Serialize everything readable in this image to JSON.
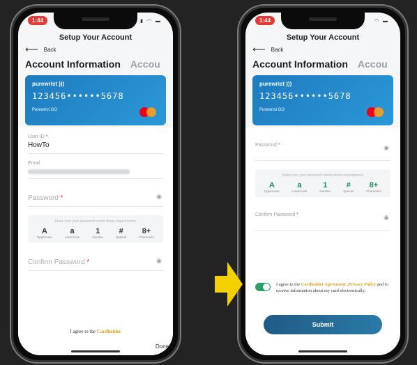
{
  "colors": {
    "accent": "#1e7bc0",
    "required": "#e53935",
    "link": "#d4a017",
    "toggle_on": "#2e9e6a",
    "pointer": "#f5d000"
  },
  "status": {
    "time": "1:44"
  },
  "screen_title": "Setup Your Account",
  "back_label": "Back",
  "tabs": {
    "active": "Account Information",
    "next": "Accou"
  },
  "card": {
    "brand": "purewrist",
    "number": "123456••••••5678",
    "plan": "Purewrist GO",
    "network_icon": "mastercard-logo"
  },
  "left": {
    "user_id": {
      "label": "User ID",
      "value": "HowTo"
    },
    "email": {
      "label": "Email"
    },
    "password": {
      "label": "Password"
    },
    "requirements": {
      "hint": "Make sure your password meets these requirements",
      "items": [
        {
          "symbol": "A",
          "caption": "Uppercase"
        },
        {
          "symbol": "a",
          "caption": "Lowercase"
        },
        {
          "symbol": "1",
          "caption": "Number"
        },
        {
          "symbol": "#",
          "caption": "Special"
        },
        {
          "symbol": "8+",
          "caption": "Characters"
        }
      ]
    },
    "confirm_password": {
      "label": "Confirm Password"
    },
    "agree_prefix": "I agree to the ",
    "agree_link": "Cardholder",
    "done": "Done"
  },
  "right": {
    "password": {
      "label": "Password"
    },
    "requirements": {
      "hint": "Make sure your password meets these requirements",
      "items": [
        {
          "symbol": "A",
          "caption": "Uppercase"
        },
        {
          "symbol": "a",
          "caption": "Lowercase"
        },
        {
          "symbol": "1",
          "caption": "Number"
        },
        {
          "symbol": "#",
          "caption": "Special"
        },
        {
          "symbol": "8+",
          "caption": "Characters"
        }
      ]
    },
    "confirm_password": {
      "label": "Confirm Password"
    },
    "agree": {
      "prefix": "I agree to the ",
      "link": "Cardholder Agreement ,Privacy Policy",
      "suffix": " and to receive information about my card electronically.",
      "toggle_on": true
    },
    "submit": "Submit"
  }
}
